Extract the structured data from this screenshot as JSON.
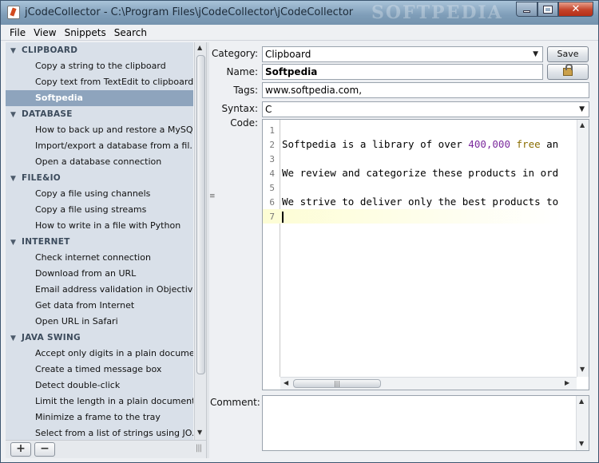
{
  "window": {
    "title": "jCodeCollector - C:\\Program Files\\jCodeCollector\\jCodeCollector",
    "watermark": "SOFTPEDIA"
  },
  "menu": [
    "File",
    "View",
    "Snippets",
    "Search"
  ],
  "tree": {
    "categories": [
      {
        "name": "CLIPBOARD",
        "items": [
          "Copy a string to the clipboard",
          "Copy text from TextEdit to clipboard",
          "Softpedia"
        ]
      },
      {
        "name": "DATABASE",
        "items": [
          "How to back up and restore a MySQ...",
          "Import/export a database from a fil...",
          "Open a database connection"
        ]
      },
      {
        "name": "FILE&IO",
        "items": [
          "Copy a file using channels",
          "Copy a file using streams",
          "How to write in a file with Python"
        ]
      },
      {
        "name": "INTERNET",
        "items": [
          "Check internet connection",
          "Download from an URL",
          "Email address validation in Objective C",
          "Get data from Internet",
          "Open URL in Safari"
        ]
      },
      {
        "name": "JAVA SWING",
        "items": [
          "Accept only digits in a plain document",
          "Create a timed message box",
          "Detect double-click",
          "Limit the length in a plain document",
          "Minimize a frame to the tray",
          "Select from a list of strings using JO..."
        ]
      }
    ],
    "selected": "Softpedia"
  },
  "form": {
    "category_label": "Category:",
    "category_value": "Clipboard",
    "save_label": "Save",
    "name_label": "Name:",
    "name_value": "Softpedia",
    "tags_label": "Tags:",
    "tags_value": "www.softpedia.com,",
    "syntax_label": "Syntax:",
    "syntax_value": "C",
    "code_label": "Code:",
    "comment_label": "Comment:"
  },
  "code": {
    "lines": [
      {
        "n": "1",
        "text": ""
      },
      {
        "n": "2",
        "text": "Softpedia is a library of over ",
        "num": "400,000",
        "kw": "free",
        "rest": " an"
      },
      {
        "n": "3",
        "text": ""
      },
      {
        "n": "4",
        "text": "We review and categorize these products in ord"
      },
      {
        "n": "5",
        "text": ""
      },
      {
        "n": "6",
        "text": "We strive to deliver only the best products to"
      },
      {
        "n": "7",
        "text": "",
        "current": true
      }
    ]
  },
  "buttons": {
    "add": "+",
    "remove": "−"
  }
}
